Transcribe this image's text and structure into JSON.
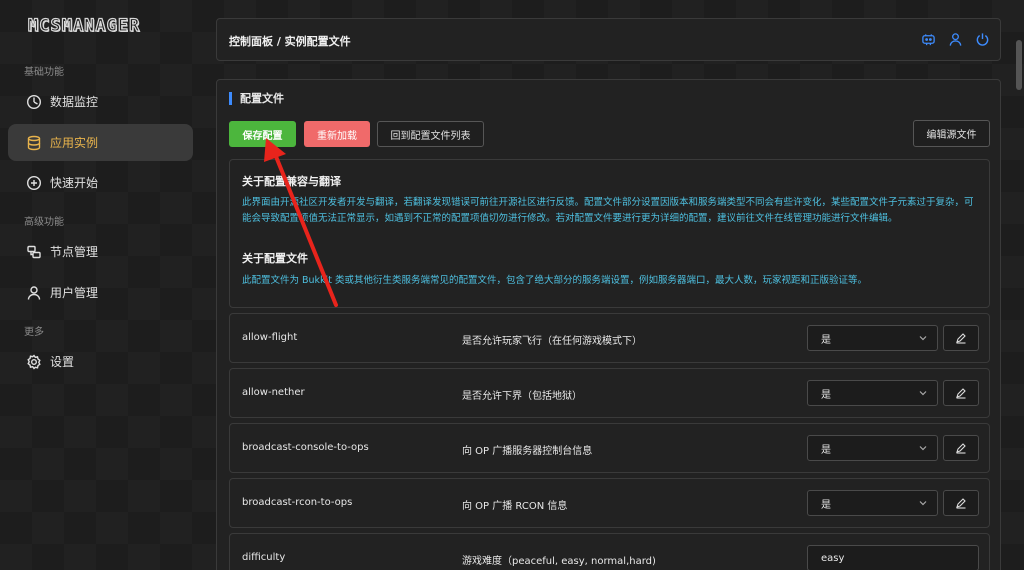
{
  "app": {
    "logo": "MCSMANAGER"
  },
  "sidebar": {
    "groups": [
      "基础功能",
      "高级功能",
      "更多"
    ],
    "items": [
      {
        "label": "数据监控",
        "icon": "dashboard-icon"
      },
      {
        "label": "应用实例",
        "icon": "database-icon"
      },
      {
        "label": "快速开始",
        "icon": "plus-circle-icon"
      },
      {
        "label": "节点管理",
        "icon": "cluster-icon"
      },
      {
        "label": "用户管理",
        "icon": "user-icon"
      },
      {
        "label": "设置",
        "icon": "gear-icon"
      }
    ],
    "active_index": 1
  },
  "header": {
    "breadcrumb": "控制面板 / 实例配置文件",
    "icons": [
      "robot-icon",
      "user-icon",
      "power-icon"
    ]
  },
  "main": {
    "section_title": "配置文件",
    "buttons": {
      "save": "保存配置",
      "reload": "重新加载",
      "back": "回到配置文件列表",
      "edit_source": "编辑源文件"
    },
    "info": {
      "heading1": "关于配置兼容与翻译",
      "text1": "此界面由开源社区开发者开发与翻译，若翻译发现错误可前往开源社区进行反馈。配置文件部分设置因版本和服务端类型不同会有些许变化，某些配置文件子元素过于复杂，可能会导致配置项值无法正常显示，如遇到不正常的配置项值切勿进行修改。若对配置文件要进行更为详细的配置，建议前往文件在线管理功能进行文件编辑。",
      "heading2": "关于配置文件",
      "text2": "此配置文件为 Bukkit 类或其他衍生类服务端常见的配置文件，包含了绝大部分的服务端设置，例如服务器端口，最大人数，玩家视距和正版验证等。"
    },
    "rows": [
      {
        "key": "allow-flight",
        "desc": "是否允许玩家飞行（在任何游戏模式下）",
        "value": "是",
        "type": "select"
      },
      {
        "key": "allow-nether",
        "desc": "是否允许下界（包括地狱）",
        "value": "是",
        "type": "select"
      },
      {
        "key": "broadcast-console-to-ops",
        "desc": "向 OP 广播服务器控制台信息",
        "value": "是",
        "type": "select"
      },
      {
        "key": "broadcast-rcon-to-ops",
        "desc": "向 OP 广播 RCON 信息",
        "value": "是",
        "type": "select"
      },
      {
        "key": "difficulty",
        "desc": "游戏难度（peaceful, easy, normal,hard)",
        "value": "easy",
        "type": "input"
      }
    ]
  },
  "colors": {
    "accent": "#e9b44c",
    "primary": "#3d8bfd",
    "save": "#4cb63d",
    "reload": "#f06a6a",
    "info_text": "#4ec0e0",
    "arrow": "#e8241c"
  }
}
